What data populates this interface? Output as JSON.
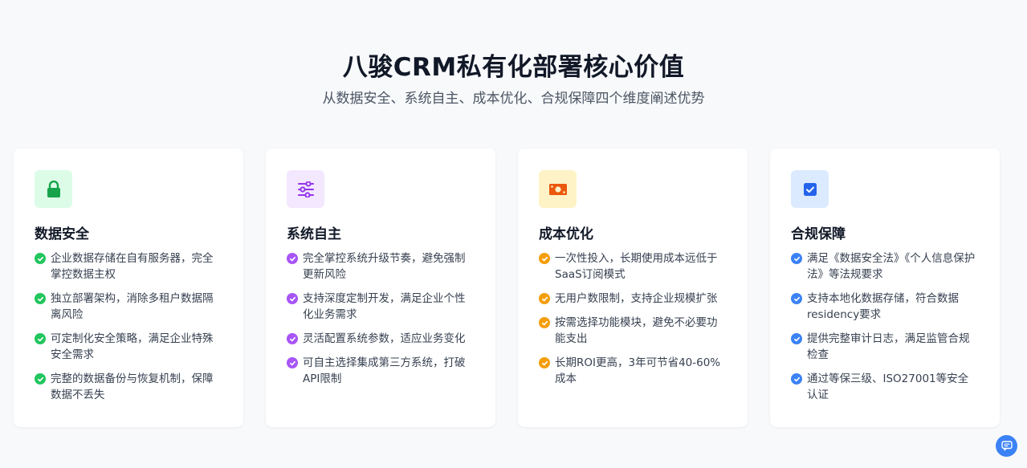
{
  "header": {
    "title": "八骏CRM私有化部署核心价值",
    "subtitle": "从数据安全、系统自主、成本优化、合规保障四个维度阐述优势"
  },
  "cards": [
    {
      "title": "数据安全",
      "icon": "lock-icon",
      "color": "#16a34a",
      "items": [
        "企业数据存储在自有服务器，完全掌控数据主权",
        "独立部署架构，消除多租户数据隔离风险",
        "可定制化安全策略，满足企业特殊安全需求",
        "完整的数据备份与恢复机制，保障数据不丢失"
      ]
    },
    {
      "title": "系统自主",
      "icon": "sliders-icon",
      "color": "#9333ea",
      "items": [
        "完全掌控系统升级节奏，避免强制更新风险",
        "支持深度定制开发，满足企业个性化业务需求",
        "灵活配置系统参数，适应业务变化",
        "可自主选择集成第三方系统，打破API限制"
      ]
    },
    {
      "title": "成本优化",
      "icon": "money-icon",
      "color": "#ea580c",
      "items": [
        "一次性投入，长期使用成本远低于SaaS订阅模式",
        "无用户数限制，支持企业规模扩张",
        "按需选择功能模块，避免不必要功能支出",
        "长期ROI更高，3年可节省40-60%成本"
      ]
    },
    {
      "title": "合规保障",
      "icon": "checkbox-icon",
      "color": "#2563eb",
      "items": [
        "满足《数据安全法》《个人信息保护法》等法规要求",
        "支持本地化数据存储，符合数据residency要求",
        "提供完整审计日志，满足监管合规检查",
        "通过等保三级、ISO27001等安全认证"
      ]
    }
  ],
  "chat": {
    "icon": "chat-icon"
  }
}
